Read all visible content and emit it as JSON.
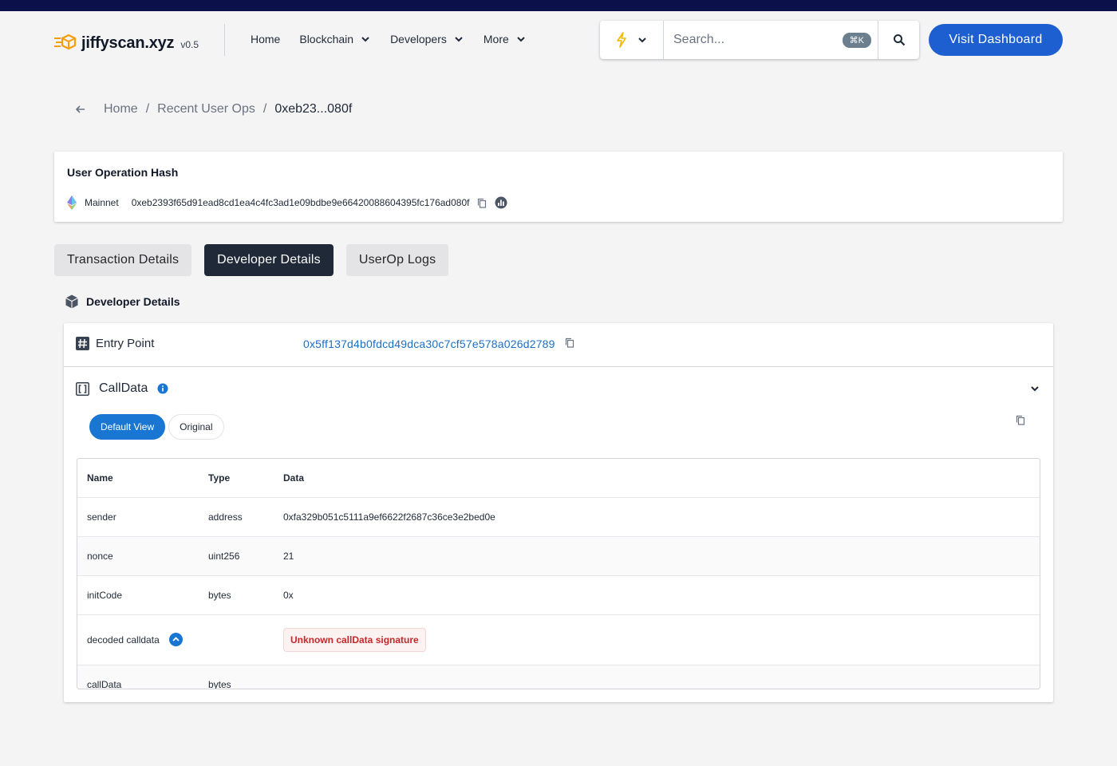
{
  "header": {
    "brand": "jiffyscan.xyz",
    "version": "v0.5",
    "nav": [
      {
        "label": "Home"
      },
      {
        "label": "Blockchain"
      },
      {
        "label": "Developers"
      },
      {
        "label": "More"
      }
    ],
    "search_placeholder": "Search...",
    "shortcut": "⌘K",
    "visit_label": "Visit Dashboard"
  },
  "breadcrumb": {
    "items": [
      "Home",
      "Recent User Ops",
      "0xeb23...080f"
    ]
  },
  "hash_card": {
    "title": "User Operation Hash",
    "network": "Mainnet",
    "hash": "0xeb2393f65d91ead8cd1ea4c4fc3ad1e09bdbe9e66420088604395fc176ad080f"
  },
  "tabs": [
    {
      "label": "Transaction Details",
      "active": false
    },
    {
      "label": "Developer Details",
      "active": true
    },
    {
      "label": "UserOp Logs",
      "active": false
    }
  ],
  "developer": {
    "section_title": "Developer Details",
    "entry_point_label": "Entry Point",
    "entry_point_value": "0x5ff137d4b0fdcd49dca30c7cf57e578a026d2789",
    "calldata_label": "CallData",
    "view_default": "Default View",
    "view_original": "Original",
    "table": {
      "headers": [
        "Name",
        "Type",
        "Data"
      ],
      "rows": [
        {
          "name": "sender",
          "type": "address",
          "data": "0xfa329b051c5111a9ef6622f2687c36ce3e2bed0e"
        },
        {
          "name": "nonce",
          "type": "uint256",
          "data": "21"
        },
        {
          "name": "initCode",
          "type": "bytes",
          "data": "0x"
        },
        {
          "name": "decoded calldata",
          "type": "",
          "data": "Unknown callData signature"
        },
        {
          "name": "callData",
          "type": "bytes",
          "data": ""
        }
      ]
    }
  },
  "colors": {
    "topbar": "#0b0f4a",
    "accent": "#1d5fd0",
    "link": "#1d6fc4",
    "active_tab": "#1f2937",
    "error": "#c62828"
  }
}
